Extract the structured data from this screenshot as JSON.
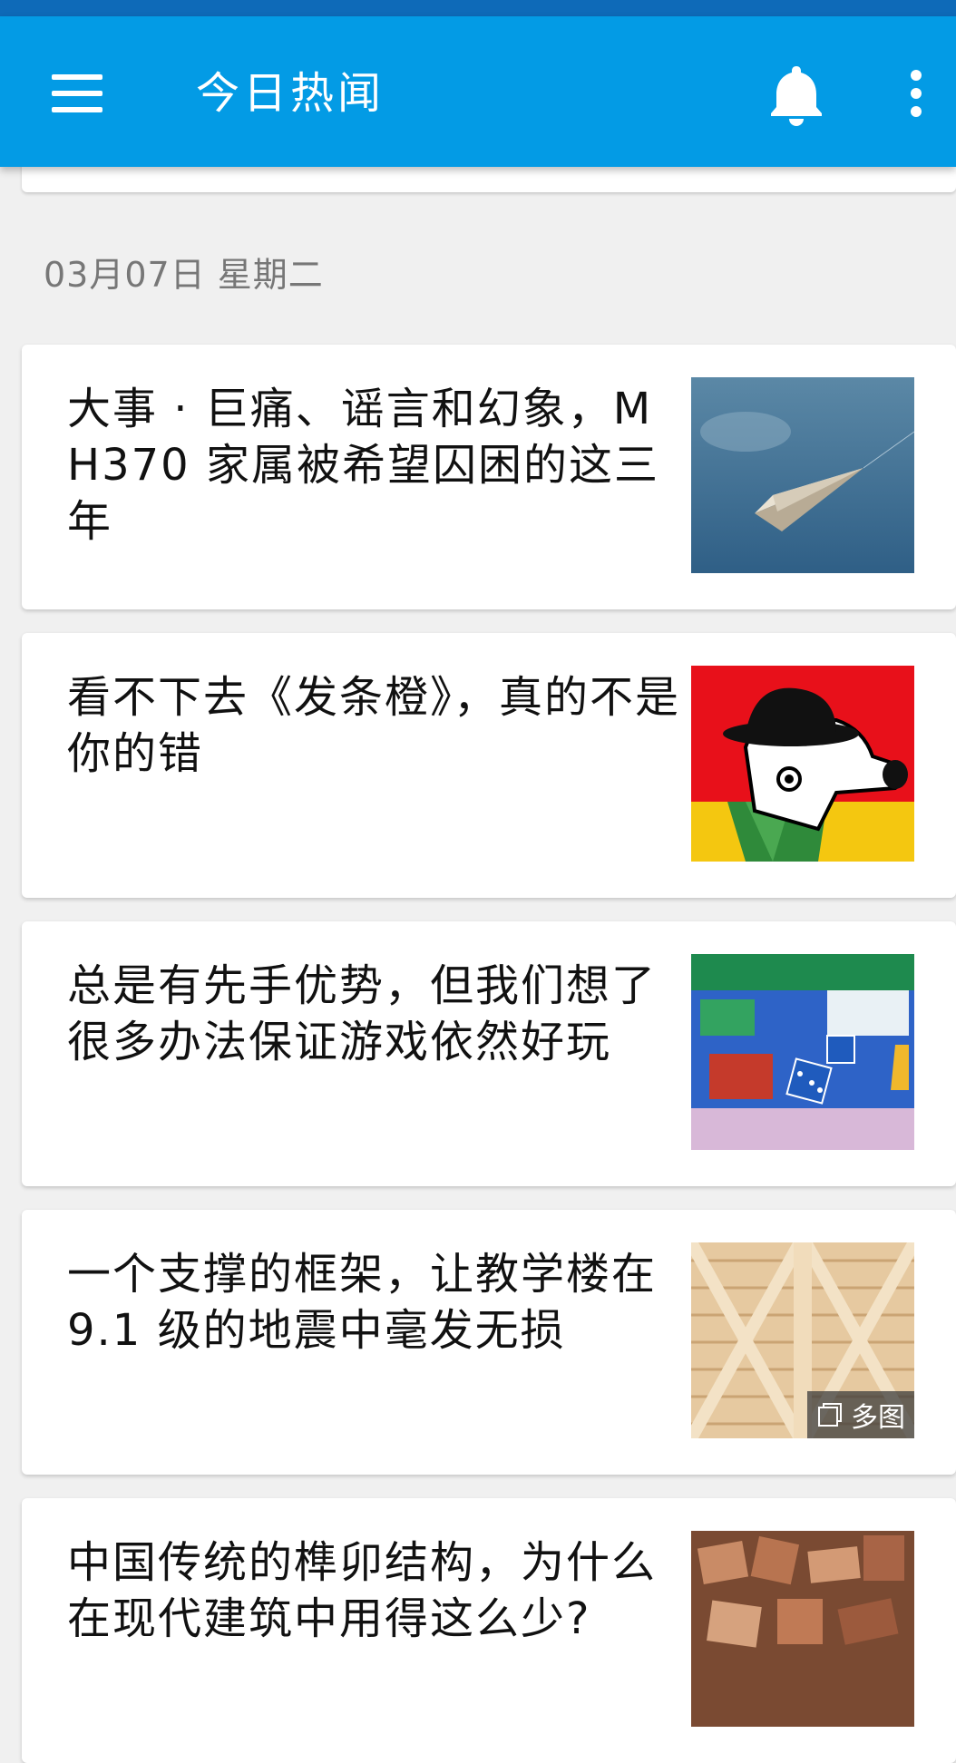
{
  "app_bar": {
    "title": "今日热闻",
    "menu_icon": "hamburger-menu-icon",
    "bell_icon": "bell-icon",
    "more_icon": "more-vertical-icon",
    "color": "#039be5"
  },
  "date_header": "03月07日 星期二",
  "stories": [
    {
      "title": "大事 · 巨痛、谣言和幻象，MH370 家属被希望囚困的这三年",
      "thumbnail": "paper-plane-image"
    },
    {
      "title": "看不下去《发条橙》，真的不是你的错",
      "thumbnail": "clockwork-orange-illustration"
    },
    {
      "title": "总是有先手优势，但我们想了很多办法保证游戏依然好玩",
      "thumbnail": "board-game-image"
    },
    {
      "title": "一个支撑的框架，让教学楼在 9.1 级的地震中毫发无损",
      "thumbnail": "lattice-frame-image",
      "badge": "多图"
    },
    {
      "title": "中国传统的榫卯结构，为什么在现代建筑中用得这么少?",
      "thumbnail": "wooden-blocks-image"
    }
  ]
}
